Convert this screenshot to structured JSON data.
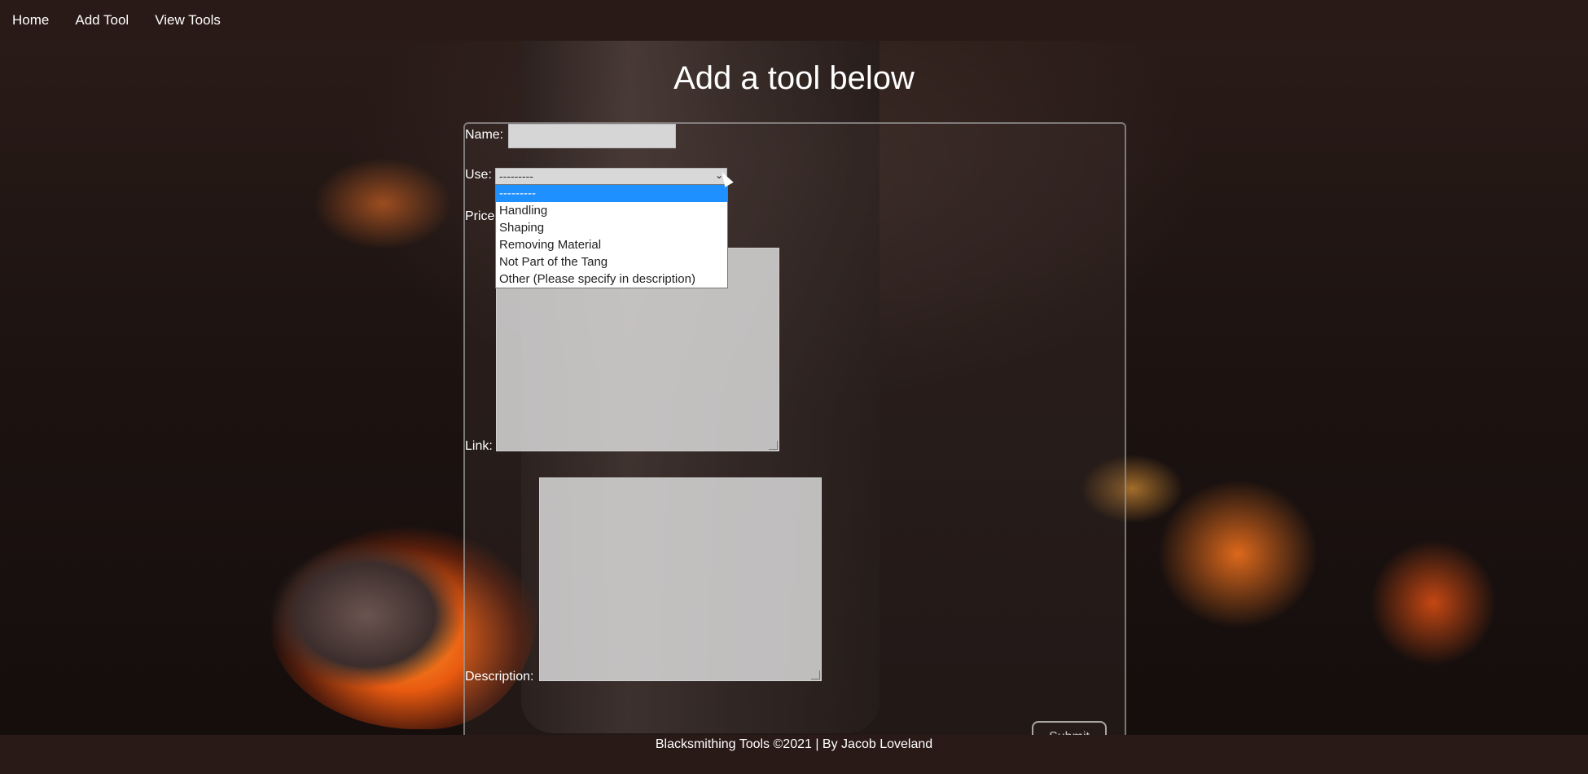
{
  "nav": {
    "home": "Home",
    "add_tool": "Add Tool",
    "view_tools": "View Tools"
  },
  "page": {
    "title": "Add a tool below"
  },
  "form": {
    "name_label": "Name:",
    "use_label": "Use:",
    "price_label": "Price",
    "link_label": "Link:",
    "description_label": "Description:",
    "use_select": {
      "selected": "---------",
      "options": [
        "---------",
        "Handling",
        "Shaping",
        "Removing Material",
        "Not Part of the Tang",
        "Other (Please specify in description)"
      ],
      "highlighted_index": 0
    },
    "submit_label": "Submit"
  },
  "footer": {
    "text": "Blacksmithing Tools ©2021 | By Jacob Loveland"
  },
  "colors": {
    "nav_bg": "#2a1a17",
    "dropdown_highlight": "#1e90ff"
  }
}
